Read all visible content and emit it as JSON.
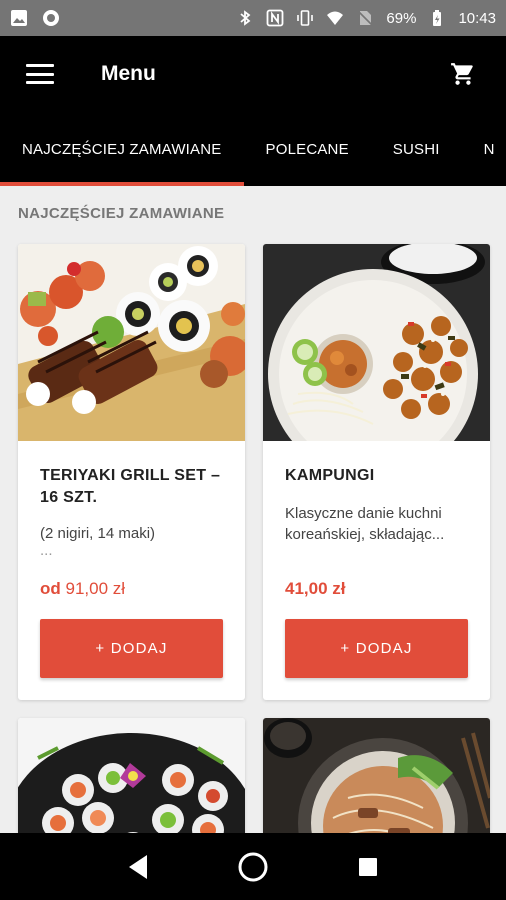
{
  "status_bar": {
    "battery": "69%",
    "time": "10:43"
  },
  "app_bar": {
    "title": "Menu",
    "menu_icon": "hamburger-icon",
    "cart_icon": "cart-icon"
  },
  "tabs": [
    {
      "label": "NAJCZĘŚCIEJ ZAMAWIANE",
      "active": true
    },
    {
      "label": "POLECANE",
      "active": false
    },
    {
      "label": "SUSHI",
      "active": false
    },
    {
      "label": "N",
      "active": false
    }
  ],
  "section_title": "NAJCZĘŚCIEJ ZAMAWIANE",
  "products": [
    {
      "name": "TERIYAKI GRILL SET – 16 SZT.",
      "description": "(2 nigiri, 14 maki)",
      "description_more": "...",
      "price_prefix": "od",
      "price": "91,00 zł",
      "button": "+ DODAJ"
    },
    {
      "name": "KAMPUNGI",
      "description": "Klasyczne danie kuchni koreańskiej, składając...",
      "price": "41,00 zł",
      "button": "+ DODAJ"
    }
  ],
  "colors": {
    "accent": "#e14d3a",
    "appbar": "#000000",
    "background": "#eeeeee"
  }
}
